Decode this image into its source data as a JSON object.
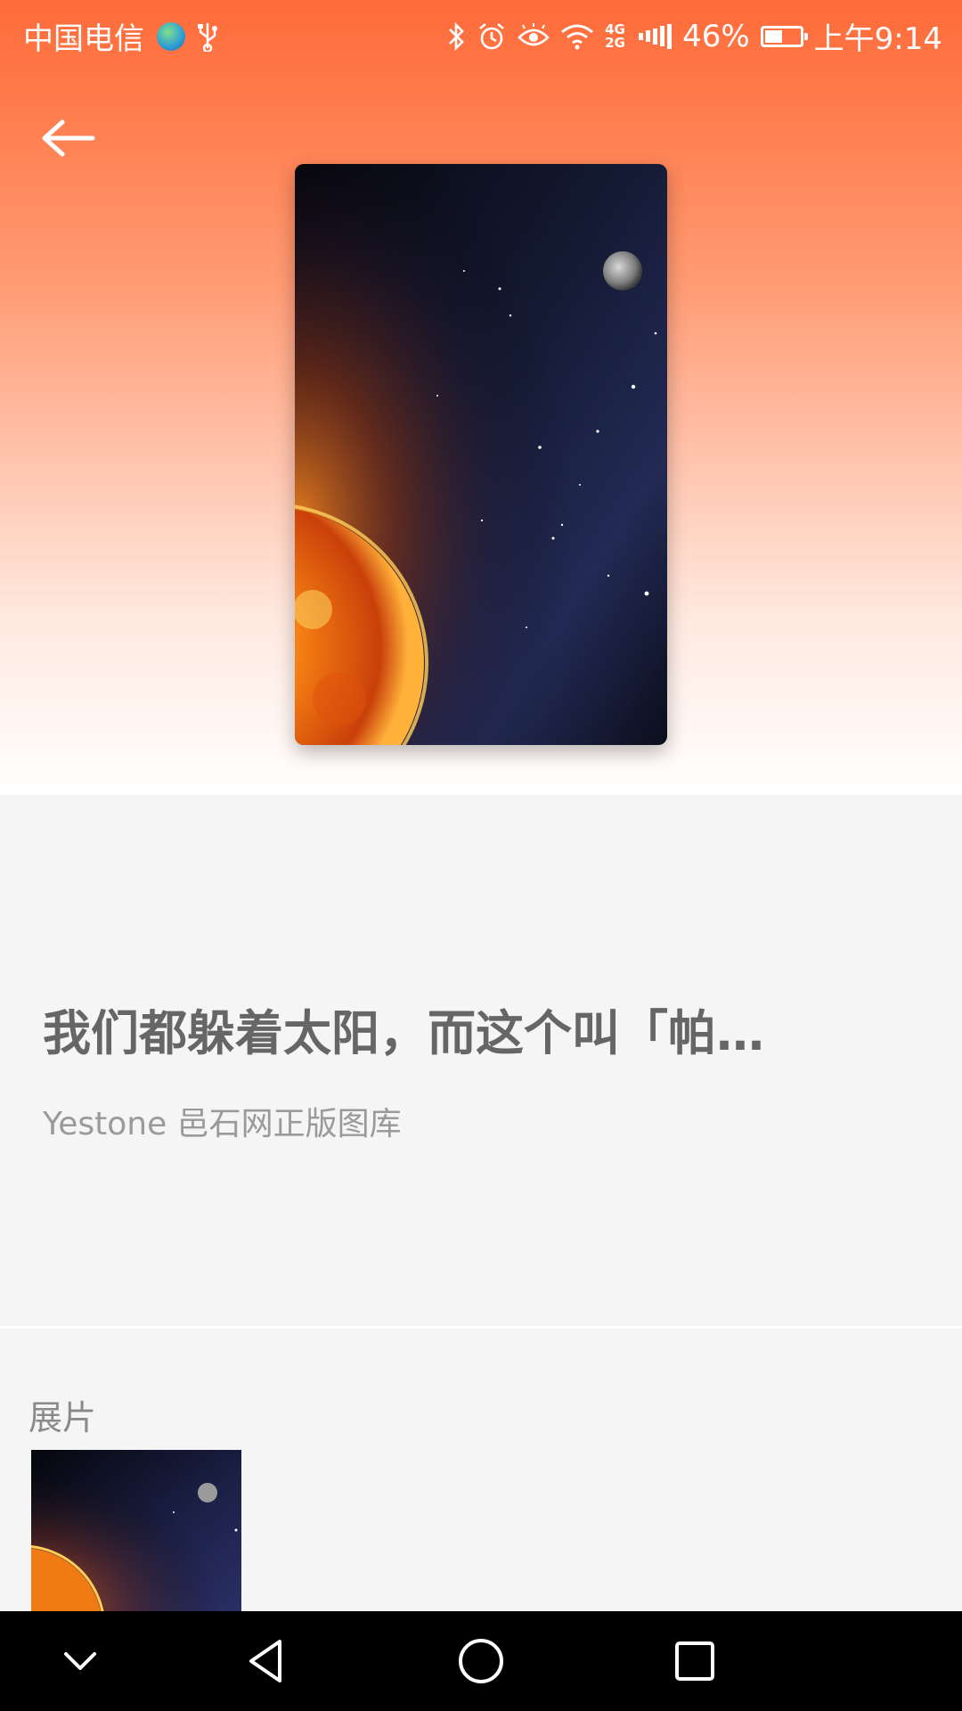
{
  "status_bar": {
    "carrier": "中国电信",
    "network_top": "4G",
    "network_bottom": "2G",
    "battery": "46%",
    "time": "上午9:14"
  },
  "artwork": {
    "title": "我们都躲着太阳，而这个叫「帕…",
    "source": "Yestone 邑石网正版图库"
  },
  "gallery": {
    "section_label": "展片"
  },
  "colors": {
    "header_top": "#ff6b3a",
    "title_text": "#666666",
    "subtitle_text": "#9a9a9a"
  }
}
